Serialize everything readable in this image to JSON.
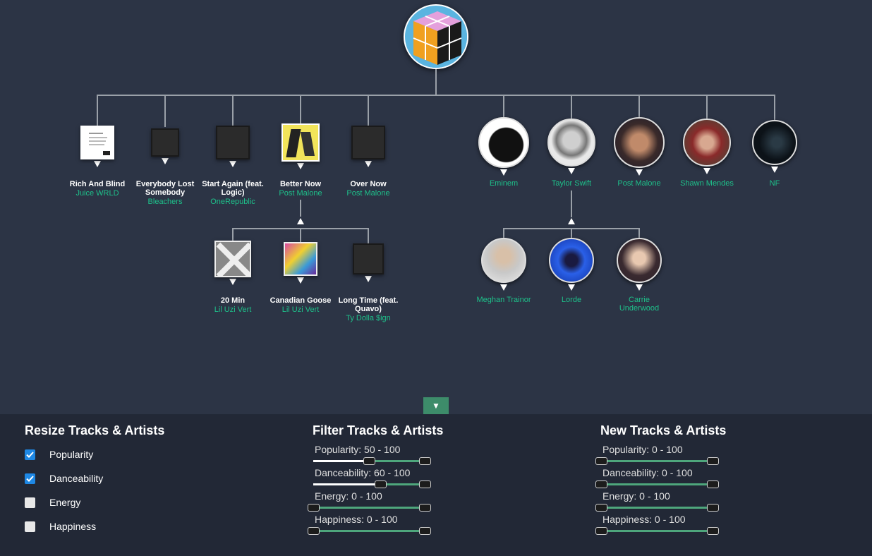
{
  "tracks": [
    {
      "title": "Rich And Blind",
      "artist": "Juice WRLD"
    },
    {
      "title": "Everybody Lost Somebody",
      "artist": "Bleachers"
    },
    {
      "title": "Start Again (feat. Logic)",
      "artist": "OneRepublic"
    },
    {
      "title": "Better Now",
      "artist": "Post Malone"
    },
    {
      "title": "Over Now",
      "artist": "Post Malone"
    }
  ],
  "track_children": [
    {
      "title": "20 Min",
      "artist": "Lil Uzi Vert"
    },
    {
      "title": "Canadian Goose",
      "artist": "Lil Uzi Vert"
    },
    {
      "title": "Long Time (feat. Quavo)",
      "artist": "Ty Dolla $ign"
    }
  ],
  "artists": [
    {
      "name": "Eminem"
    },
    {
      "name": "Taylor Swift"
    },
    {
      "name": "Post Malone"
    },
    {
      "name": "Shawn Mendes"
    },
    {
      "name": "NF"
    }
  ],
  "artist_children": [
    {
      "name": "Meghan Trainor"
    },
    {
      "name": "Lorde"
    },
    {
      "name": "Carrie Underwood"
    }
  ],
  "toggle_icon": "▼",
  "panel": {
    "resize": {
      "title": "Resize Tracks & Artists",
      "options": [
        {
          "label": "Popularity",
          "checked": true
        },
        {
          "label": "Danceability",
          "checked": true
        },
        {
          "label": "Energy",
          "checked": false
        },
        {
          "label": "Happiness",
          "checked": false
        }
      ]
    },
    "filter": {
      "title": "Filter Tracks & Artists",
      "sliders": [
        {
          "label": "Popularity: 50 - 100",
          "min": 50,
          "max": 100
        },
        {
          "label": "Danceability: 60 - 100",
          "min": 60,
          "max": 100
        },
        {
          "label": "Energy: 0 - 100",
          "min": 0,
          "max": 100
        },
        {
          "label": "Happiness: 0 - 100",
          "min": 0,
          "max": 100
        }
      ]
    },
    "new": {
      "title": "New Tracks & Artists",
      "sliders": [
        {
          "label": "Popularity: 0 - 100",
          "min": 0,
          "max": 100
        },
        {
          "label": "Danceability: 0 - 100",
          "min": 0,
          "max": 100
        },
        {
          "label": "Energy: 0 - 100",
          "min": 0,
          "max": 100
        },
        {
          "label": "Happiness: 0 - 100",
          "min": 0,
          "max": 100
        }
      ]
    }
  },
  "colors": {
    "accent": "#1ec08a",
    "slider_track": "#4ea67c",
    "toggle": "#3d8c6a",
    "checkbox_on": "#1e88e5"
  }
}
